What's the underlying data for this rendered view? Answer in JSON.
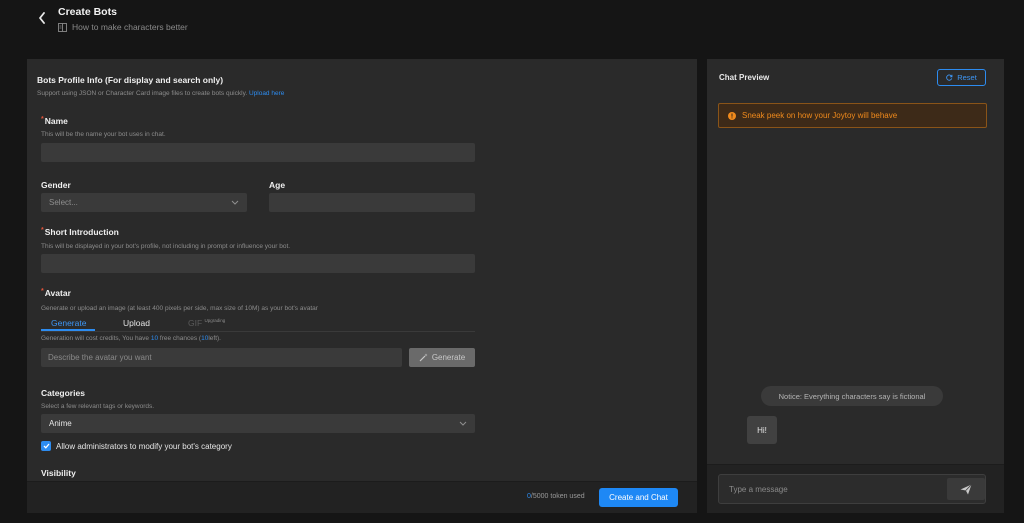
{
  "header": {
    "title": "Create Bots",
    "subtitle_link": "How to make characters better"
  },
  "form": {
    "profile_title": "Bots Profile Info (For display and search only)",
    "profile_hint": "Support using JSON or Character Card image files to create bots quickly.",
    "upload_link": "Upload here",
    "name": {
      "label": "Name",
      "hint": "This will be the name your bot uses in chat.",
      "value": ""
    },
    "gender": {
      "label": "Gender",
      "placeholder": "Select..."
    },
    "age": {
      "label": "Age",
      "value": ""
    },
    "short_intro": {
      "label": "Short Introduction",
      "hint": "This will be displayed in your bot's profile, not including in prompt or influence your bot.",
      "value": ""
    },
    "avatar": {
      "label": "Avatar",
      "hint": "Generate or upload an image (at least 400 pixels per side, max size of 10M) as your bot's avatar",
      "tabs": [
        "Generate",
        "Upload",
        "GIF"
      ],
      "gif_badge": "Upgrading",
      "credits_text_before": "Generation will cost credits, You have",
      "free_count": "10",
      "credits_text_middle": "free chances (",
      "left_count": "10",
      "credits_text_after": "left).",
      "prompt_placeholder": "Describe the avatar you want",
      "generate_label": "Generate"
    },
    "categories": {
      "label": "Categories",
      "hint": "Select a few relevant tags or keywords.",
      "selected": "Anime"
    },
    "allow_admin": {
      "label": "Allow administrators to modify your bot's category",
      "checked": true
    },
    "visibility": {
      "label": "Visibility"
    }
  },
  "footer": {
    "token_used": "0",
    "token_total": "/5000 token used",
    "create_label": "Create and Chat"
  },
  "chat": {
    "title": "Chat Preview",
    "reset_label": "Reset",
    "banner_text": "Sneak peek on how your Joytoy will behave",
    "notice": "Notice: Everything characters say is fictional",
    "bot_message": "Hi!",
    "input_placeholder": "Type a message"
  },
  "colors": {
    "accent": "#2d8cf0",
    "warning": "#f08a1c",
    "required": "#e0533a"
  },
  "icons": [
    "chevron-left-icon",
    "book-icon",
    "chevron-down-icon",
    "magic-wand-icon",
    "check-icon",
    "refresh-icon",
    "info-icon",
    "send-icon"
  ]
}
